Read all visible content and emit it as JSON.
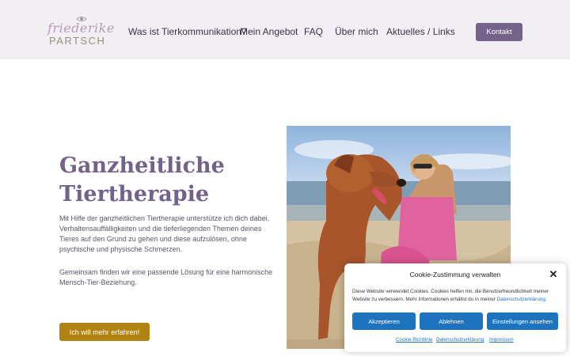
{
  "header": {
    "logo": {
      "script_text": "friederike",
      "name_text": "PARTSCH"
    },
    "nav": [
      {
        "label": "Was ist Tierkommunikation?"
      },
      {
        "label": "Mein Angebot"
      },
      {
        "label": "FAQ"
      },
      {
        "label": "Über mich"
      },
      {
        "label": "Aktuelles / Links"
      }
    ],
    "contact_button": "Kontakt"
  },
  "hero": {
    "title_line1": "Ganzheitliche",
    "title_line2": "Tiertherapie",
    "paragraph1": "Mit Hilfe der ganzheitlichen Tiertherapie unterstütze ich dich dabei, Verhaltensauffälligkeiten und die tieferliegenden Themen deines Tieres auf den Grund zu gehen und diese aufzulösen, ohne psychische und physische Schmerzen.",
    "paragraph2": "Gemeinsam finden wir eine passende Lösung für eine harmonische Mensch-Tier-Beziehung.",
    "cta_button": "Ich will mehr erfahren!"
  },
  "cookie_banner": {
    "title": "Cookie-Zustimmung verwalten",
    "text": "Diese Website verwendet Cookies. Cookies helfen mir, die Benutzerfreundlichkeit meiner Website zu verbessern. Mehr Informationen erhältst du in meiner",
    "text_link": "Datenschutzerklärung",
    "text_end": ".",
    "accept": "Akzeptieren",
    "decline": "Ablehnen",
    "settings": "Einstellungen ansehen",
    "footer_links": [
      "Cookie-Richtlinie",
      "Datenschutzerklärung",
      "Impressum"
    ]
  },
  "colors": {
    "brand_purple": "#73628a",
    "header_bg": "#f1eef4",
    "cta_gold": "#b08212",
    "cookie_blue": "#1e73be"
  }
}
